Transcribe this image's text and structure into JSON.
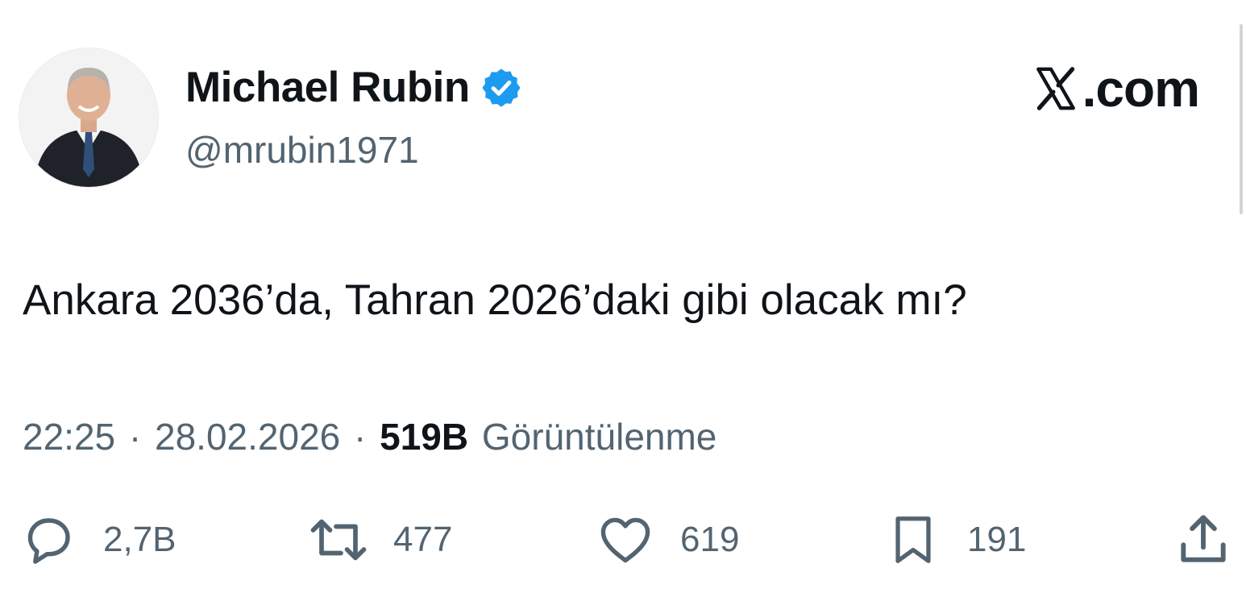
{
  "author": {
    "name": "Michael Rubin",
    "handle": "@mrubin1971",
    "verified": true,
    "verified_color": "#1d9bf0"
  },
  "brand": {
    "text": ".com",
    "icon": "x-logo-icon"
  },
  "tweet": {
    "text": "Ankara 2036’da, Tahran 2026’daki gibi olacak mı?"
  },
  "meta": {
    "time": "22:25",
    "separator": "·",
    "date": "28.02.2026",
    "views_count": "519B",
    "views_label": "Görüntülenme"
  },
  "actions": {
    "replies": {
      "icon": "reply-icon",
      "count": "2,7B"
    },
    "reposts": {
      "icon": "repost-icon",
      "count": "477"
    },
    "likes": {
      "icon": "heart-icon",
      "count": "619"
    },
    "bookmarks": {
      "icon": "bookmark-icon",
      "count": "191"
    },
    "share": {
      "icon": "share-icon"
    }
  },
  "colors": {
    "text_primary": "#0f1419",
    "text_secondary": "#536471",
    "background": "#ffffff"
  }
}
